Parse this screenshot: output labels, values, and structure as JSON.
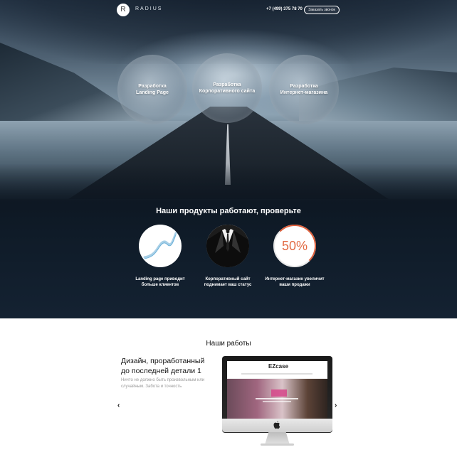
{
  "header": {
    "logo_letter": "R",
    "brand": "RADIUS",
    "phone": "+7 (499) 375 78 70",
    "callback_label": "Заказать звонок"
  },
  "services": [
    {
      "line1": "Разработка",
      "line2": "Landing Page"
    },
    {
      "line1": "Разработка",
      "line2": "Корпоративного сайта"
    },
    {
      "line1": "Разработка",
      "line2": "Интернет-магазина"
    }
  ],
  "products": {
    "title": "Наши продукты работают, проверьте",
    "items": [
      {
        "icon": "chart-line-icon",
        "line1": "Landing page приводит",
        "line2": "больше клиентов"
      },
      {
        "icon": "tuxedo-icon",
        "line1": "Корпоративный сайт",
        "line2": "поднимает ваш статус"
      },
      {
        "icon": "percent-ring-icon",
        "value": "50%",
        "percent": 50,
        "line1": "Интернет-магазин увеличит",
        "line2": "ваши продажи"
      }
    ]
  },
  "works": {
    "title": "Наши работы",
    "item_title_line1": "Дизайн, проработанный",
    "item_title_line2": "до последней детали 1",
    "item_desc": "Ничто не должно быть произвольным или случайным. Забота и точность",
    "prev_arrow": "‹",
    "next_arrow": "›",
    "screen_logo": "EZcase"
  },
  "colors": {
    "accent": "#e0603c",
    "hero_bg": "#142232"
  }
}
